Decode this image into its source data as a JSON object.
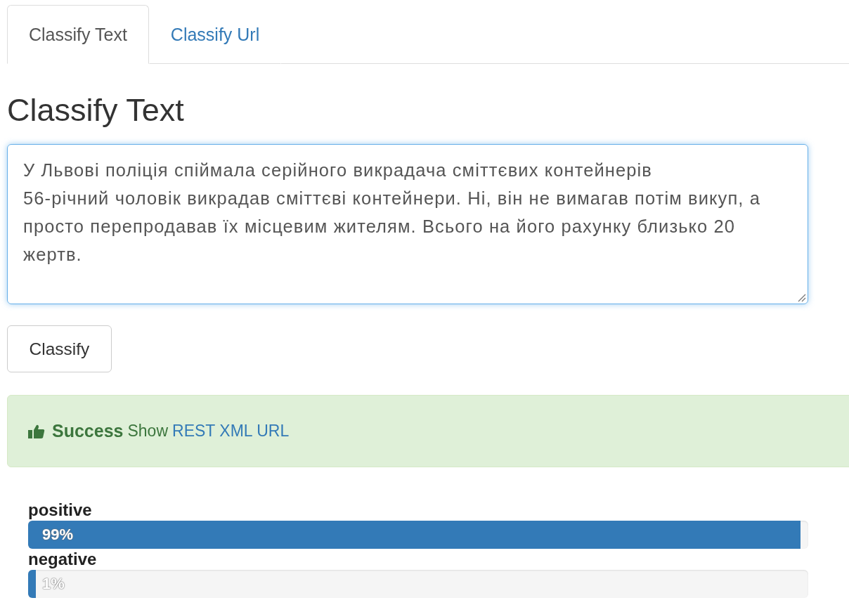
{
  "tabs": [
    {
      "label": "Classify Text",
      "selected": true
    },
    {
      "label": "Classify Url",
      "selected": false
    }
  ],
  "heading": "Classify Text",
  "text_field": {
    "value": "У Львові поліція спіймала серійного викрадача сміттєвих контейнерів\n56-річний чоловік викрадав сміттєві контейнери. Ні, він не вимагав потім викуп, а просто перепродавав їх місцевим жителям. Всього на його рахунку близько 20 жертв."
  },
  "classify_button": "Classify",
  "alert": {
    "title": "Success",
    "text": "Show",
    "link": "REST XML URL"
  },
  "results": [
    {
      "label": "positive",
      "level": 0.99,
      "reading": "99%"
    },
    {
      "label": "negative",
      "level": 0.01,
      "reading": "1%"
    }
  ]
}
